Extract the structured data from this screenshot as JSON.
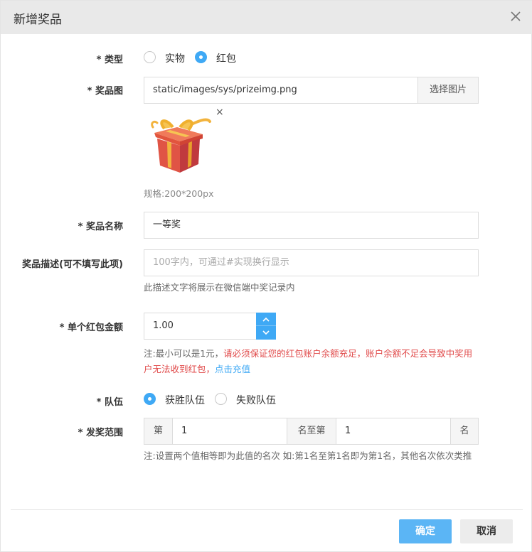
{
  "dialog": {
    "title": "新增奖品",
    "close_icon": "close-icon"
  },
  "form": {
    "type": {
      "label": "* 类型",
      "options": [
        "实物",
        "红包"
      ],
      "selected": "红包"
    },
    "image": {
      "label": "* 奖品图",
      "value": "static/images/sys/prizeimg.png",
      "button_label": "选择图片",
      "remove_symbol": "×",
      "preview_icon": "gift-box-icon",
      "spec_hint": "规格:200*200px"
    },
    "name": {
      "label": "* 奖品名称",
      "value": "一等奖"
    },
    "description": {
      "label": "奖品描述(可不填写此项)",
      "placeholder": "100字内，可通过#实现换行显示",
      "hint": "此描述文字将展示在微信端中奖记录内"
    },
    "amount": {
      "label": "* 单个红包金额",
      "value": "1.00",
      "hint_prefix": "注:最小可以是1元，",
      "hint_warning": "请必须保证您的红包账户余额充足，账户余额不足会导致中奖用户无法收到红包，",
      "hint_link": "点击充值"
    },
    "team": {
      "label": "* 队伍",
      "options": [
        "获胜队伍",
        "失败队伍"
      ],
      "selected": "获胜队伍"
    },
    "range": {
      "label": "* 发奖范围",
      "prefix": "第",
      "from": "1",
      "middle": "名至第",
      "to": "1",
      "suffix": "名",
      "hint": "注:设置两个值相等即为此值的名次 如:第1名至第1名即为第1名，其他名次依次类推"
    }
  },
  "footer": {
    "confirm_label": "确定",
    "cancel_label": "取消"
  },
  "colors": {
    "accent": "#3fa9f5",
    "warning": "#e04848",
    "header_bg": "#e9e9e9"
  }
}
